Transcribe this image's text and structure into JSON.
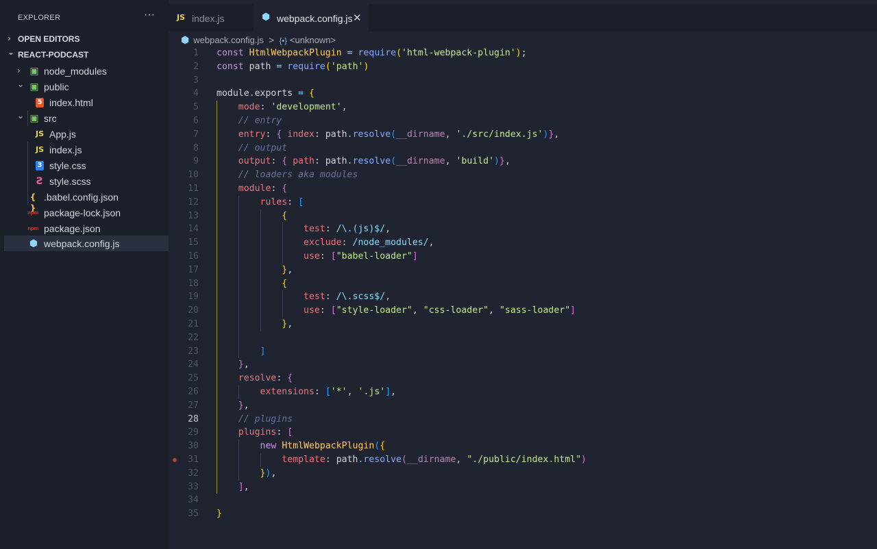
{
  "explorer": {
    "title": "EXPLORER",
    "more_label": "···",
    "sections": [
      {
        "label": "OPEN EDITORS",
        "chevron": "›"
      },
      {
        "label": "REACT-PODCAST",
        "chevron": "⌄"
      }
    ],
    "tree": [
      {
        "name": "node_modules",
        "icon": "folder-node-icon",
        "chevron": "›"
      },
      {
        "name": "public",
        "icon": "folder-public-icon",
        "chevron": "⌄"
      },
      {
        "name": "index.html",
        "icon": "html-file-icon"
      },
      {
        "name": "src",
        "icon": "folder-src-icon",
        "chevron": "⌄"
      },
      {
        "name": "App.js",
        "icon": "js-file-icon"
      },
      {
        "name": "index.js",
        "icon": "js-file-icon"
      },
      {
        "name": "style.css",
        "icon": "css-file-icon"
      },
      {
        "name": "style.scss",
        "icon": "scss-file-icon"
      },
      {
        "name": ".babel.config.json",
        "icon": "json-file-icon"
      },
      {
        "name": "package-lock.json",
        "icon": "npm-file-icon"
      },
      {
        "name": "package.json",
        "icon": "npm-file-icon"
      },
      {
        "name": "webpack.config.js",
        "icon": "webpack-file-icon",
        "active": true
      }
    ]
  },
  "icons": {
    "js": "JS",
    "html": "5",
    "css": "3",
    "scss": "Ƨ",
    "json": "{ }",
    "npm": "npm",
    "webpack": "⬢",
    "folder": "▣"
  },
  "tabs": [
    {
      "label": "index.js",
      "icon": "js-file-icon",
      "active": false
    },
    {
      "label": "webpack.config.js",
      "icon": "webpack-file-icon",
      "active": true,
      "close": "✕"
    }
  ],
  "breadcrumb": {
    "file": "webpack.config.js",
    "separator": ">",
    "symbol_icon": "{•}",
    "symbol": "<unknown>"
  },
  "editor": {
    "current_line": 28,
    "breakpoint_line": 31,
    "colors": {
      "background": "#1f2430",
      "sidebar": "#1b1f29",
      "keyword": "#c792ea",
      "string": "#c3e88d",
      "property": "#f07178",
      "comment": "#697098"
    },
    "lines": [
      "const HtmlWebpackPlugin = require('html-webpack-plugin');",
      "const path = require('path')",
      "",
      "module.exports = {",
      "    mode: 'development',",
      "    // entry",
      "    entry: { index: path.resolve(__dirname, './src/index.js')},",
      "    // output",
      "    output: { path: path.resolve(__dirname, 'build')},",
      "    // loaders aka modules",
      "    module: {",
      "        rules: [",
      "            {",
      "                test: /\\.(js)$/,",
      "                exclude: /node_modules/,",
      "                use: [\"babel-loader\"]",
      "            },",
      "            {",
      "                test: /\\.scss$/,",
      "                use: [\"style-loader\", \"css-loader\", \"sass-loader\"]",
      "            },",
      "",
      "        ]",
      "    },",
      "    resolve: {",
      "        extensions: ['*', '.js'],",
      "    },",
      "    // plugins",
      "    plugins: [",
      "        new HtmlWebpackPlugin({",
      "            template: path.resolve(__dirname, \"./public/index.html\")",
      "        }),",
      "    ],",
      "",
      "}"
    ]
  }
}
